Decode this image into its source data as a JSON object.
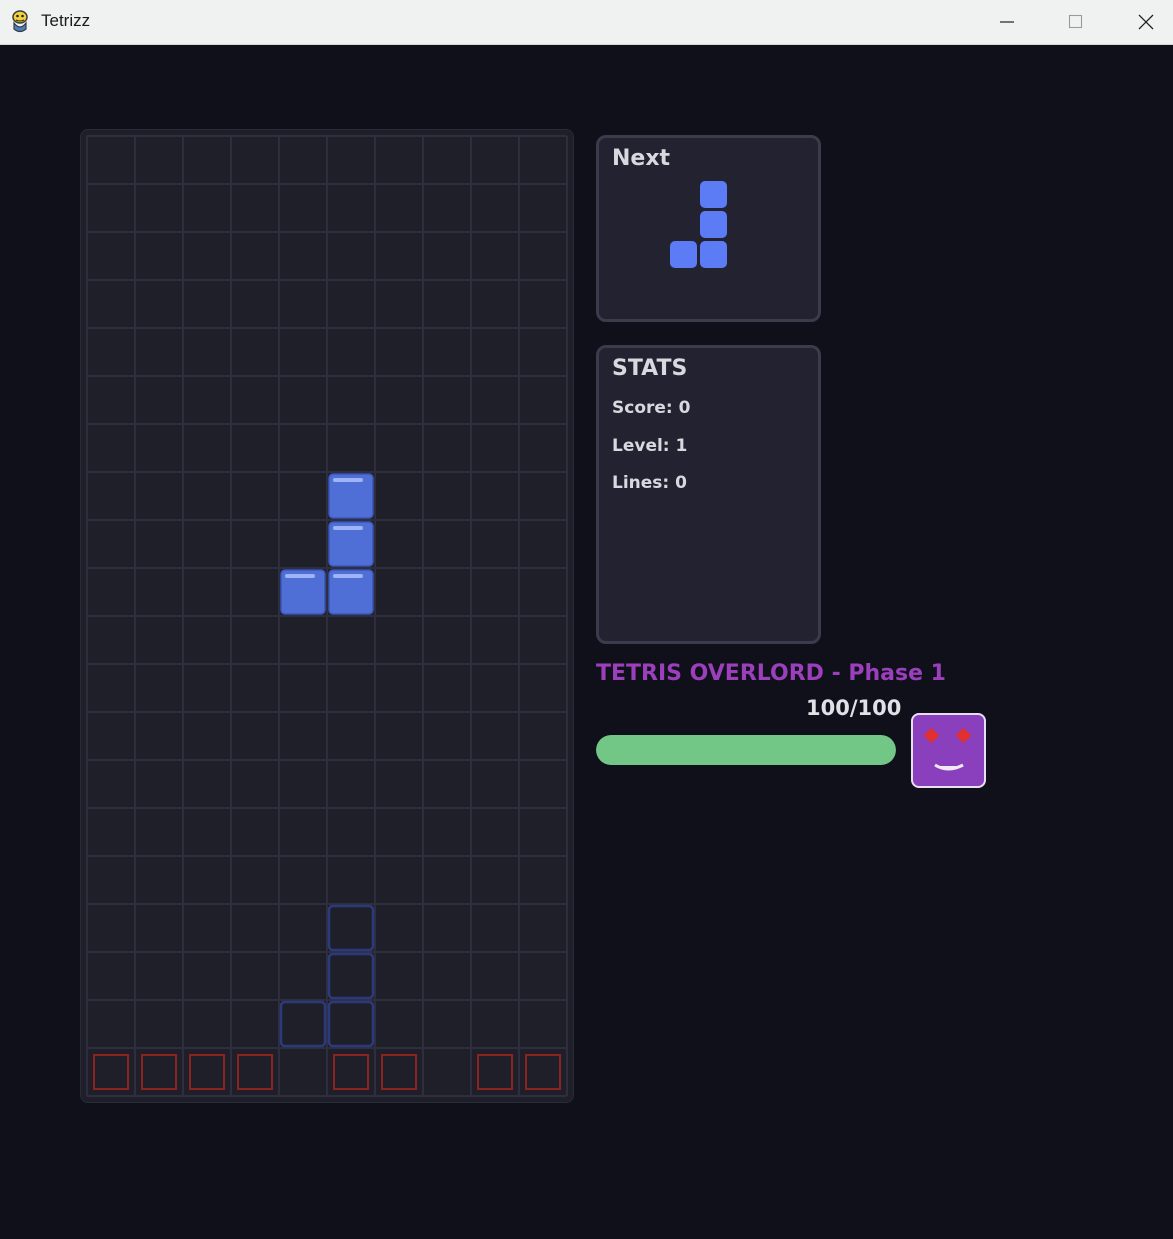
{
  "window": {
    "title": "Tetrizz",
    "app_icon": "python-snake-icon",
    "controls": [
      "minimize-icon",
      "maximize-icon",
      "close-icon"
    ]
  },
  "board": {
    "columns": 10,
    "rows": 20,
    "active_piece": {
      "shape": "J",
      "color": "#4f6fd6",
      "cells": [
        [
          5,
          7
        ],
        [
          5,
          8
        ],
        [
          4,
          9
        ],
        [
          5,
          9
        ]
      ]
    },
    "ghost_piece": {
      "color": "#2a3a7a",
      "cells": [
        [
          5,
          16
        ],
        [
          5,
          17
        ],
        [
          4,
          18
        ],
        [
          5,
          18
        ]
      ]
    },
    "garbage_row": {
      "row": 19,
      "color": "#8c2323",
      "filled_columns": [
        0,
        1,
        2,
        3,
        5,
        6,
        8,
        9
      ]
    }
  },
  "next_panel": {
    "title": "Next",
    "piece_shape": "J",
    "piece_color": "#5b7cf5"
  },
  "stats_panel": {
    "title": "STATS",
    "score": "Score: 0",
    "level": "Level: 1",
    "lines": "Lines: 0"
  },
  "boss": {
    "title": "TETRIS OVERLORD - Phase 1",
    "hp_text": "100/100",
    "hp_fraction": 1.0,
    "hp_color": "#72c686",
    "avatar_color": "#8a3fbd",
    "eye_color": "#e03030"
  }
}
